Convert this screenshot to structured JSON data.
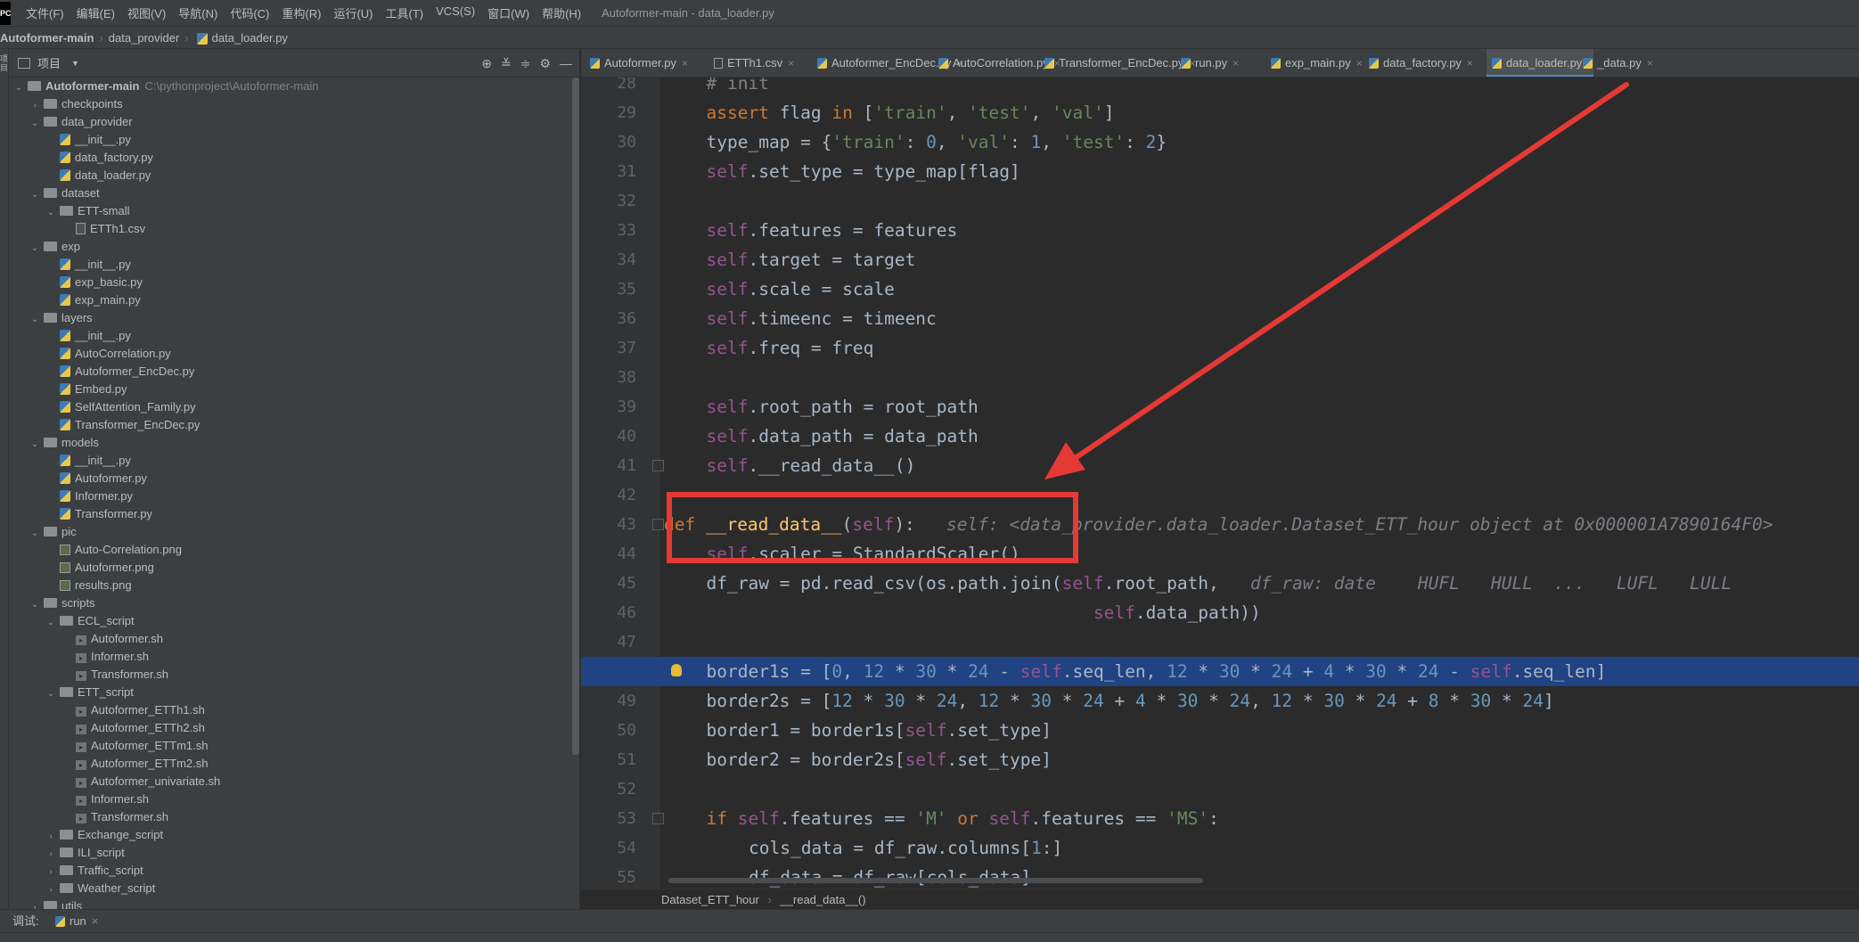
{
  "app": {
    "logo": "PC",
    "window_title": "Autoformer-main - data_loader.py"
  },
  "menu": [
    "文件(F)",
    "编辑(E)",
    "视图(V)",
    "导航(N)",
    "代码(C)",
    "重构(R)",
    "运行(U)",
    "工具(T)",
    "VCS(S)",
    "窗口(W)",
    "帮助(H)"
  ],
  "navbar": {
    "project": "Autoformer-main",
    "folder": "data_provider",
    "file": "data_loader.py"
  },
  "toolstrip_label": "项目",
  "project_panel": {
    "title": "项目",
    "root_path": "C:\\pythonproject\\Autoformer-main"
  },
  "tree": [
    {
      "label": "Autoformer-main",
      "depth": 0,
      "kind": "folder",
      "state": "open",
      "bold": true
    },
    {
      "label": "checkpoints",
      "depth": 1,
      "kind": "folder",
      "state": "closed"
    },
    {
      "label": "data_provider",
      "depth": 1,
      "kind": "folder",
      "state": "open"
    },
    {
      "label": "__init__.py",
      "depth": 2,
      "kind": "py"
    },
    {
      "label": "data_factory.py",
      "depth": 2,
      "kind": "py"
    },
    {
      "label": "data_loader.py",
      "depth": 2,
      "kind": "py"
    },
    {
      "label": "dataset",
      "depth": 1,
      "kind": "folder",
      "state": "open"
    },
    {
      "label": "ETT-small",
      "depth": 2,
      "kind": "folder",
      "state": "open"
    },
    {
      "label": "ETTh1.csv",
      "depth": 3,
      "kind": "csv"
    },
    {
      "label": "exp",
      "depth": 1,
      "kind": "folder",
      "state": "open"
    },
    {
      "label": "__init__.py",
      "depth": 2,
      "kind": "py"
    },
    {
      "label": "exp_basic.py",
      "depth": 2,
      "kind": "py"
    },
    {
      "label": "exp_main.py",
      "depth": 2,
      "kind": "py"
    },
    {
      "label": "layers",
      "depth": 1,
      "kind": "folder",
      "state": "open"
    },
    {
      "label": "__init__.py",
      "depth": 2,
      "kind": "py"
    },
    {
      "label": "AutoCorrelation.py",
      "depth": 2,
      "kind": "py"
    },
    {
      "label": "Autoformer_EncDec.py",
      "depth": 2,
      "kind": "py"
    },
    {
      "label": "Embed.py",
      "depth": 2,
      "kind": "py"
    },
    {
      "label": "SelfAttention_Family.py",
      "depth": 2,
      "kind": "py"
    },
    {
      "label": "Transformer_EncDec.py",
      "depth": 2,
      "kind": "py"
    },
    {
      "label": "models",
      "depth": 1,
      "kind": "folder",
      "state": "open"
    },
    {
      "label": "__init__.py",
      "depth": 2,
      "kind": "py"
    },
    {
      "label": "Autoformer.py",
      "depth": 2,
      "kind": "py"
    },
    {
      "label": "Informer.py",
      "depth": 2,
      "kind": "py"
    },
    {
      "label": "Transformer.py",
      "depth": 2,
      "kind": "py"
    },
    {
      "label": "pic",
      "depth": 1,
      "kind": "folder",
      "state": "open"
    },
    {
      "label": "Auto-Correlation.png",
      "depth": 2,
      "kind": "png"
    },
    {
      "label": "Autoformer.png",
      "depth": 2,
      "kind": "png"
    },
    {
      "label": "results.png",
      "depth": 2,
      "kind": "png"
    },
    {
      "label": "scripts",
      "depth": 1,
      "kind": "folder",
      "state": "open"
    },
    {
      "label": "ECL_script",
      "depth": 2,
      "kind": "folder",
      "state": "open"
    },
    {
      "label": "Autoformer.sh",
      "depth": 3,
      "kind": "sh"
    },
    {
      "label": "Informer.sh",
      "depth": 3,
      "kind": "sh"
    },
    {
      "label": "Transformer.sh",
      "depth": 3,
      "kind": "sh"
    },
    {
      "label": "ETT_script",
      "depth": 2,
      "kind": "folder",
      "state": "open"
    },
    {
      "label": "Autoformer_ETTh1.sh",
      "depth": 3,
      "kind": "sh"
    },
    {
      "label": "Autoformer_ETTh2.sh",
      "depth": 3,
      "kind": "sh"
    },
    {
      "label": "Autoformer_ETTm1.sh",
      "depth": 3,
      "kind": "sh"
    },
    {
      "label": "Autoformer_ETTm2.sh",
      "depth": 3,
      "kind": "sh"
    },
    {
      "label": "Autoformer_univariate.sh",
      "depth": 3,
      "kind": "sh"
    },
    {
      "label": "Informer.sh",
      "depth": 3,
      "kind": "sh"
    },
    {
      "label": "Transformer.sh",
      "depth": 3,
      "kind": "sh"
    },
    {
      "label": "Exchange_script",
      "depth": 2,
      "kind": "folder",
      "state": "closed"
    },
    {
      "label": "ILI_script",
      "depth": 2,
      "kind": "folder",
      "state": "closed"
    },
    {
      "label": "Traffic_script",
      "depth": 2,
      "kind": "folder",
      "state": "closed"
    },
    {
      "label": "Weather_script",
      "depth": 2,
      "kind": "folder",
      "state": "closed"
    },
    {
      "label": "utils",
      "depth": 1,
      "kind": "folder",
      "state": "closed"
    }
  ],
  "tabs": [
    {
      "label": "Autoformer.py",
      "kind": "py",
      "active": false
    },
    {
      "label": "ETTh1.csv",
      "kind": "csv",
      "active": false
    },
    {
      "label": "Autoformer_EncDec.py",
      "kind": "py",
      "active": false
    },
    {
      "label": "AutoCorrelation.py",
      "kind": "py",
      "active": false
    },
    {
      "label": "Transformer_EncDec.py",
      "kind": "py",
      "active": false
    },
    {
      "label": "run.py",
      "kind": "py",
      "active": false
    },
    {
      "label": "exp_main.py",
      "kind": "py",
      "active": false
    },
    {
      "label": "data_factory.py",
      "kind": "py",
      "active": false
    },
    {
      "label": "data_loader.py",
      "kind": "py",
      "active": true
    },
    {
      "label": "_data.py",
      "kind": "py",
      "active": false
    }
  ],
  "code_lines": [
    {
      "n": 28,
      "indent": 1,
      "tokens": [
        [
          "cmt",
          "# init"
        ]
      ]
    },
    {
      "n": 29,
      "indent": 1,
      "tokens": [
        [
          "kw",
          "assert "
        ],
        [
          "",
          "flag "
        ],
        [
          "kw",
          "in "
        ],
        [
          "",
          "["
        ],
        [
          "str",
          "'train'"
        ],
        [
          "",
          ", "
        ],
        [
          "str",
          "'test'"
        ],
        [
          "",
          ", "
        ],
        [
          "str",
          "'val'"
        ],
        [
          "",
          "]"
        ]
      ]
    },
    {
      "n": 30,
      "indent": 1,
      "tokens": [
        [
          "",
          "type_map = {"
        ],
        [
          "str",
          "'train'"
        ],
        [
          "",
          ": "
        ],
        [
          "num",
          "0"
        ],
        [
          "",
          ", "
        ],
        [
          "str",
          "'val'"
        ],
        [
          "",
          ": "
        ],
        [
          "num",
          "1"
        ],
        [
          "",
          ", "
        ],
        [
          "str",
          "'test'"
        ],
        [
          "",
          ": "
        ],
        [
          "num",
          "2"
        ],
        [
          "",
          "}"
        ]
      ]
    },
    {
      "n": 31,
      "indent": 1,
      "tokens": [
        [
          "slf",
          "self"
        ],
        [
          "",
          ".set_type = type_map[flag]"
        ]
      ]
    },
    {
      "n": 32,
      "indent": 0,
      "tokens": []
    },
    {
      "n": 33,
      "indent": 1,
      "tokens": [
        [
          "slf",
          "self"
        ],
        [
          "",
          ".features = features"
        ]
      ]
    },
    {
      "n": 34,
      "indent": 1,
      "tokens": [
        [
          "slf",
          "self"
        ],
        [
          "",
          ".target = target"
        ]
      ]
    },
    {
      "n": 35,
      "indent": 1,
      "tokens": [
        [
          "slf",
          "self"
        ],
        [
          "",
          ".scale = scale"
        ]
      ]
    },
    {
      "n": 36,
      "indent": 1,
      "tokens": [
        [
          "slf",
          "self"
        ],
        [
          "",
          ".timeenc = timeenc"
        ]
      ]
    },
    {
      "n": 37,
      "indent": 1,
      "tokens": [
        [
          "slf",
          "self"
        ],
        [
          "",
          ".freq = freq"
        ]
      ]
    },
    {
      "n": 38,
      "indent": 0,
      "tokens": []
    },
    {
      "n": 39,
      "indent": 1,
      "tokens": [
        [
          "slf",
          "self"
        ],
        [
          "",
          ".root_path = root_path"
        ]
      ]
    },
    {
      "n": 40,
      "indent": 1,
      "tokens": [
        [
          "slf",
          "self"
        ],
        [
          "",
          ".data_path = data_path"
        ]
      ]
    },
    {
      "n": 41,
      "indent": 1,
      "tokens": [
        [
          "slf",
          "self"
        ],
        [
          "",
          ".__read_data__()"
        ]
      ]
    },
    {
      "n": 42,
      "indent": 0,
      "tokens": []
    },
    {
      "n": 43,
      "indent": 0,
      "tokens": [
        [
          "kw",
          "def "
        ],
        [
          "fn",
          "__read_data__"
        ],
        [
          "",
          "("
        ],
        [
          "slf",
          "self"
        ],
        [
          "",
          "):   "
        ],
        [
          "hint",
          "self: <data_provider.data_loader.Dataset_ETT_hour object at 0x000001A7890164F0>"
        ]
      ]
    },
    {
      "n": 44,
      "indent": 1,
      "tokens": [
        [
          "slf",
          "self"
        ],
        [
          "",
          ".scaler = StandardScaler()"
        ]
      ]
    },
    {
      "n": 45,
      "indent": 1,
      "tokens": [
        [
          "",
          "df_raw = pd.read_csv(os.path.join("
        ],
        [
          "slf",
          "self"
        ],
        [
          "",
          ".root_path,   "
        ],
        [
          "hint",
          "df_raw: date    HUFL   HULL  ...   LUFL   LULL"
        ]
      ]
    },
    {
      "n": 46,
      "indent": 1,
      "tokens": [
        [
          "",
          "                                     "
        ],
        [
          "slf",
          "self"
        ],
        [
          "",
          ".data_path))"
        ]
      ]
    },
    {
      "n": 47,
      "indent": 0,
      "tokens": []
    },
    {
      "n": 48,
      "indent": 1,
      "tokens": [
        [
          "",
          "border1s = ["
        ],
        [
          "num",
          "0"
        ],
        [
          "",
          ", "
        ],
        [
          "num",
          "12"
        ],
        [
          "",
          " * "
        ],
        [
          "num",
          "30"
        ],
        [
          "",
          " * "
        ],
        [
          "num",
          "24"
        ],
        [
          "",
          " - "
        ],
        [
          "slf",
          "self"
        ],
        [
          "",
          ".seq_len, "
        ],
        [
          "num",
          "12"
        ],
        [
          "",
          " * "
        ],
        [
          "num",
          "30"
        ],
        [
          "",
          " * "
        ],
        [
          "num",
          "24"
        ],
        [
          "",
          " + "
        ],
        [
          "num",
          "4"
        ],
        [
          "",
          " * "
        ],
        [
          "num",
          "30"
        ],
        [
          "",
          " * "
        ],
        [
          "num",
          "24"
        ],
        [
          "",
          " - "
        ],
        [
          "slf",
          "self"
        ],
        [
          "",
          ".seq_len]"
        ]
      ]
    },
    {
      "n": 49,
      "indent": 1,
      "tokens": [
        [
          "",
          "border2s = ["
        ],
        [
          "num",
          "12"
        ],
        [
          "",
          " * "
        ],
        [
          "num",
          "30"
        ],
        [
          "",
          " * "
        ],
        [
          "num",
          "24"
        ],
        [
          "",
          ", "
        ],
        [
          "num",
          "12"
        ],
        [
          "",
          " * "
        ],
        [
          "num",
          "30"
        ],
        [
          "",
          " * "
        ],
        [
          "num",
          "24"
        ],
        [
          "",
          " + "
        ],
        [
          "num",
          "4"
        ],
        [
          "",
          " * "
        ],
        [
          "num",
          "30"
        ],
        [
          "",
          " * "
        ],
        [
          "num",
          "24"
        ],
        [
          "",
          ", "
        ],
        [
          "num",
          "12"
        ],
        [
          "",
          " * "
        ],
        [
          "num",
          "30"
        ],
        [
          "",
          " * "
        ],
        [
          "num",
          "24"
        ],
        [
          "",
          " + "
        ],
        [
          "num",
          "8"
        ],
        [
          "",
          " * "
        ],
        [
          "num",
          "30"
        ],
        [
          "",
          " * "
        ],
        [
          "num",
          "24"
        ],
        [
          "",
          "]"
        ]
      ]
    },
    {
      "n": 50,
      "indent": 1,
      "tokens": [
        [
          "",
          "border1 = border1s["
        ],
        [
          "slf",
          "self"
        ],
        [
          "",
          ".set_type]"
        ]
      ]
    },
    {
      "n": 51,
      "indent": 1,
      "tokens": [
        [
          "",
          "border2 = border2s["
        ],
        [
          "slf",
          "self"
        ],
        [
          "",
          ".set_type]"
        ]
      ]
    },
    {
      "n": 52,
      "indent": 0,
      "tokens": []
    },
    {
      "n": 53,
      "indent": 1,
      "tokens": [
        [
          "kw",
          "if "
        ],
        [
          "slf",
          "self"
        ],
        [
          "",
          ".features == "
        ],
        [
          "str",
          "'M'"
        ],
        [
          "kw",
          " or "
        ],
        [
          "slf",
          "self"
        ],
        [
          "",
          ".features == "
        ],
        [
          "str",
          "'MS'"
        ],
        [
          "",
          ":"
        ]
      ]
    },
    {
      "n": 54,
      "indent": 2,
      "tokens": [
        [
          "",
          "cols_data = df_raw.columns["
        ],
        [
          "num",
          "1"
        ],
        [
          "",
          ":]"
        ]
      ]
    },
    {
      "n": 55,
      "indent": 2,
      "tokens": [
        [
          "",
          "df_data = df_raw[cols_data]"
        ]
      ]
    }
  ],
  "current_line": 48,
  "editor_breadcrumb": {
    "cls": "Dataset_ETT_hour",
    "method": "__read_data__()"
  },
  "bottom": {
    "debug_label": "调试:",
    "run_label": "run"
  },
  "colors": {
    "annotation": "#e53935",
    "selection": "#214283",
    "accent": "#4a88c7"
  }
}
